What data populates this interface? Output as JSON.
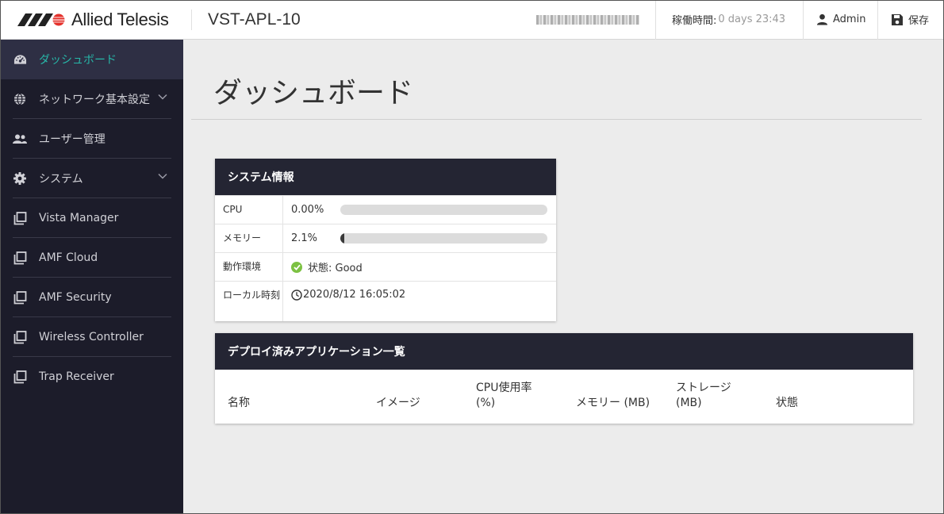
{
  "header": {
    "brand": "Allied Telesis",
    "product": "VST-APL-10",
    "uptime_label": "稼働時間:",
    "uptime_value": "0 days 23:43",
    "user": "Admin",
    "save": "保存",
    "colors": {
      "brand_red": "#e4312b",
      "brand_dark": "#222222"
    }
  },
  "sidebar": {
    "items": [
      {
        "label": "ダッシュボード",
        "icon": "dashboard-icon",
        "active": true
      },
      {
        "label": "ネットワーク基本設定",
        "icon": "globe-icon",
        "expandable": true
      },
      {
        "label": "ユーザー管理",
        "icon": "users-icon"
      },
      {
        "label": "システム",
        "icon": "gear-icon",
        "expandable": true
      },
      {
        "label": "Vista Manager",
        "icon": "windows-icon"
      },
      {
        "label": "AMF Cloud",
        "icon": "windows-icon"
      },
      {
        "label": "AMF Security",
        "icon": "windows-icon"
      },
      {
        "label": "Wireless Controller",
        "icon": "windows-icon"
      },
      {
        "label": "Trap Receiver",
        "icon": "windows-icon"
      }
    ],
    "colors": {
      "background": "#1c1c2a",
      "active_bg": "#2e2f44",
      "active_text": "#27b7a8"
    }
  },
  "main": {
    "title": "ダッシュボード",
    "system_info": {
      "heading": "システム情報",
      "cpu_label": "CPU",
      "cpu_value": "0.00%",
      "cpu_fraction": 0.0,
      "memory_label": "メモリー",
      "memory_value": "2.1%",
      "memory_fraction": 0.021,
      "env_label": "動作環境",
      "env_value": "状態: Good",
      "time_label": "ローカル時刻",
      "time_value": "2020/8/12 16:05:02"
    },
    "apps": {
      "heading": "デプロイ済みアプリケーション一覧",
      "columns": [
        "名称",
        "イメージ",
        "CPU使用率 (%)",
        "メモリー (MB)",
        "ストレージ (MB)",
        "状態"
      ]
    }
  }
}
